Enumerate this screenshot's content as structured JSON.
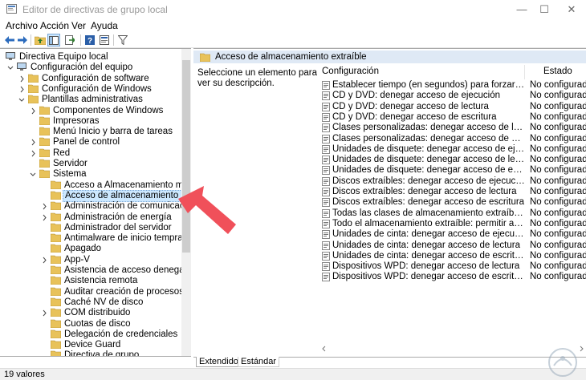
{
  "window": {
    "title": "Editor de directivas de grupo local",
    "buttons": {
      "minimize": "—",
      "maximize": "☐",
      "close": "✕"
    }
  },
  "menu": [
    "Archivo",
    "Acción",
    "Ver",
    "Ayuda"
  ],
  "toolbar": {
    "icons": [
      "back-icon",
      "forward-icon",
      "up-folder-icon",
      "show-hide-tree-icon",
      "export-list-icon",
      "help-icon",
      "properties-icon",
      "filter-icon"
    ]
  },
  "tree": {
    "items": [
      {
        "label": "Directiva Equipo local",
        "depth": 0,
        "expander": "",
        "icon": "computer-policy-icon"
      },
      {
        "label": "Configuración del equipo",
        "depth": 1,
        "expander": "open",
        "icon": "computer-icon"
      },
      {
        "label": "Configuración de software",
        "depth": 2,
        "expander": "closed",
        "icon": "folder-icon"
      },
      {
        "label": "Configuración de Windows",
        "depth": 2,
        "expander": "closed",
        "icon": "folder-icon"
      },
      {
        "label": "Plantillas administrativas",
        "depth": 2,
        "expander": "open",
        "icon": "folder-icon"
      },
      {
        "label": "Componentes de Windows",
        "depth": 3,
        "expander": "closed",
        "icon": "folder-icon"
      },
      {
        "label": "Impresoras",
        "depth": 3,
        "expander": "",
        "icon": "folder-icon"
      },
      {
        "label": "Menú Inicio y barra de tareas",
        "depth": 3,
        "expander": "",
        "icon": "folder-icon"
      },
      {
        "label": "Panel de control",
        "depth": 3,
        "expander": "closed",
        "icon": "folder-icon"
      },
      {
        "label": "Red",
        "depth": 3,
        "expander": "closed",
        "icon": "folder-icon"
      },
      {
        "label": "Servidor",
        "depth": 3,
        "expander": "",
        "icon": "folder-icon"
      },
      {
        "label": "Sistema",
        "depth": 3,
        "expander": "open",
        "icon": "folder-icon"
      },
      {
        "label": "Acceso a Almacenamiento mejorado",
        "depth": 4,
        "expander": "",
        "icon": "folder-icon"
      },
      {
        "label": "Acceso de almacenamiento extraíble",
        "depth": 4,
        "expander": "",
        "icon": "folder-icon",
        "selected": true
      },
      {
        "label": "Administración de comunicaciones de",
        "depth": 4,
        "expander": "closed",
        "icon": "folder-icon"
      },
      {
        "label": "Administración de energía",
        "depth": 4,
        "expander": "closed",
        "icon": "folder-icon"
      },
      {
        "label": "Administrador del servidor",
        "depth": 4,
        "expander": "",
        "icon": "folder-icon"
      },
      {
        "label": "Antimalware de inicio temprano",
        "depth": 4,
        "expander": "",
        "icon": "folder-icon"
      },
      {
        "label": "Apagado",
        "depth": 4,
        "expander": "",
        "icon": "folder-icon"
      },
      {
        "label": "App-V",
        "depth": 4,
        "expander": "closed",
        "icon": "folder-icon"
      },
      {
        "label": "Asistencia de acceso denegado",
        "depth": 4,
        "expander": "",
        "icon": "folder-icon"
      },
      {
        "label": "Asistencia remota",
        "depth": 4,
        "expander": "",
        "icon": "folder-icon"
      },
      {
        "label": "Auditar creación de procesos",
        "depth": 4,
        "expander": "",
        "icon": "folder-icon"
      },
      {
        "label": "Caché NV de disco",
        "depth": 4,
        "expander": "",
        "icon": "folder-icon"
      },
      {
        "label": "COM distribuido",
        "depth": 4,
        "expander": "closed",
        "icon": "folder-icon"
      },
      {
        "label": "Cuotas de disco",
        "depth": 4,
        "expander": "",
        "icon": "folder-icon"
      },
      {
        "label": "Delegación de credenciales",
        "depth": 4,
        "expander": "",
        "icon": "folder-icon"
      },
      {
        "label": "Device Guard",
        "depth": 4,
        "expander": "",
        "icon": "folder-icon"
      },
      {
        "label": "Directiva de grupo",
        "depth": 4,
        "expander": "",
        "icon": "folder-icon"
      }
    ]
  },
  "details": {
    "header_title": "Acceso de almacenamiento extraíble",
    "description": "Seleccione un elemento para ver su descripción.",
    "columns": {
      "name": "Configuración",
      "state": "Estado"
    },
    "policies": [
      {
        "name": "Establecer tiempo (en segundos) para forzar reinicio",
        "state": "No configurada"
      },
      {
        "name": "CD y DVD: denegar acceso de ejecución",
        "state": "No configurada"
      },
      {
        "name": "CD y DVD: denegar acceso de lectura",
        "state": "No configurada"
      },
      {
        "name": "CD y DVD: denegar acceso de escritura",
        "state": "No configurada"
      },
      {
        "name": "Clases personalizadas: denegar acceso de lectura",
        "state": "No configurada"
      },
      {
        "name": "Clases personalizadas: denegar acceso de escritura",
        "state": "No configurada"
      },
      {
        "name": "Unidades de disquete: denegar acceso de ejecución",
        "state": "No configurada"
      },
      {
        "name": "Unidades de disquete: denegar acceso de lectura",
        "state": "No configurada"
      },
      {
        "name": "Unidades de disquete: denegar acceso de escritura",
        "state": "No configurada"
      },
      {
        "name": "Discos extraíbles: denegar acceso de ejecución",
        "state": "No configurada"
      },
      {
        "name": "Discos extraíbles: denegar acceso de lectura",
        "state": "No configurada"
      },
      {
        "name": "Discos extraíbles: denegar acceso de escritura",
        "state": "No configurada"
      },
      {
        "name": "Todas las clases de almacenamiento extraíble: denegar acce…",
        "state": "No configurada"
      },
      {
        "name": "Todo el almacenamiento extraíble: permitir acceso directo e…",
        "state": "No configurada"
      },
      {
        "name": "Unidades de cinta: denegar acceso de ejecución",
        "state": "No configurada"
      },
      {
        "name": "Unidades de cinta: denegar acceso de lectura",
        "state": "No configurada"
      },
      {
        "name": "Unidades de cinta: denegar acceso de escritura",
        "state": "No configurada"
      },
      {
        "name": "Dispositivos WPD: denegar acceso de lectura",
        "state": "No configurada"
      },
      {
        "name": "Dispositivos WPD: denegar acceso de escritura",
        "state": "No configurada"
      }
    ]
  },
  "tabs": [
    "Extendido",
    "Estándar"
  ],
  "status": {
    "text": "19 valores"
  },
  "colors": {
    "selection": "#cce8ff",
    "header_strip": "#dfe9f5",
    "folder": "#e8c25a",
    "arrow": "#f0505a"
  }
}
